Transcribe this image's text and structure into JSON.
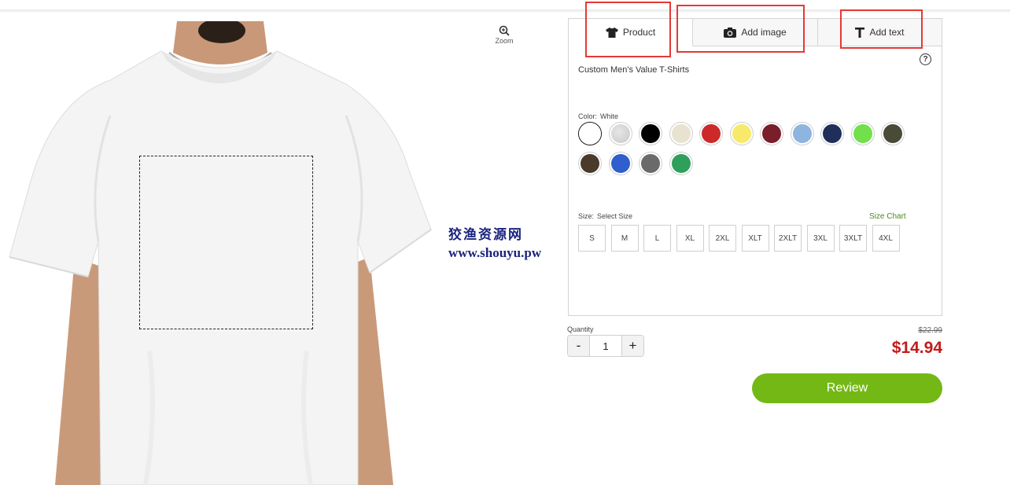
{
  "preview": {
    "zoom_label": "Zoom",
    "zoom_icon": "zoom-in-icon"
  },
  "watermark": {
    "chinese": "狡渔资源网",
    "url": "www.shouyu.pw"
  },
  "tabs": [
    {
      "label": "Product",
      "icon": "tshirt-icon"
    },
    {
      "label": "Add image",
      "icon": "camera-icon"
    },
    {
      "label": "Add text",
      "icon": "text-icon"
    }
  ],
  "help_icon": "?",
  "product_name": "Custom Men's Value T-Shirts",
  "color": {
    "label": "Color:",
    "selected": "White",
    "swatches": [
      "#ffffff",
      "#d4d4d4",
      "#000000",
      "#e8e2d0",
      "#cc2a2a",
      "#f7ea6a",
      "#7a1e2a",
      "#8fb4e0",
      "#1f2f5a",
      "#72e04a",
      "#4a4a38",
      "#4a3a2c",
      "#2f5fcc",
      "#6a6a6a",
      "#2fa05a"
    ]
  },
  "size": {
    "label": "Size:",
    "selected": "Select Size",
    "chart_link": "Size Chart",
    "options": [
      "S",
      "M",
      "L",
      "XL",
      "2XL",
      "XLT",
      "2XLT",
      "3XL",
      "3XLT",
      "4XL"
    ]
  },
  "quantity": {
    "label": "Quantity",
    "minus": "-",
    "value": "1",
    "plus": "+"
  },
  "price": {
    "old": "$22.99",
    "new": "$14.94"
  },
  "review_button": "Review",
  "colors": {
    "accent_green": "#74b816",
    "price_red": "#c21b1b",
    "highlight_red": "#e53935"
  }
}
